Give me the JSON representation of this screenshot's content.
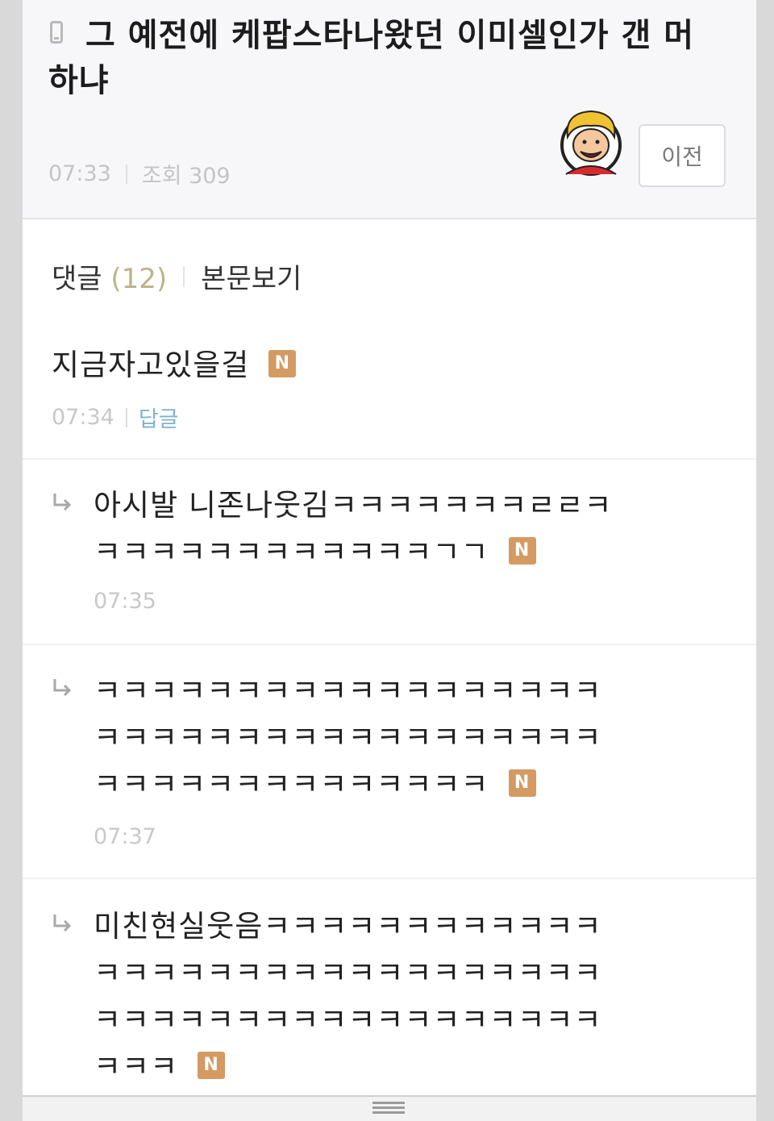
{
  "post": {
    "title": "그 예전에 케팝스타나왔던 이미셀인가 갠 머하냐",
    "time": "07:33",
    "views": "조회 309",
    "prev_button": "이전"
  },
  "comment_tabs": {
    "comments_label": "댓글",
    "comments_count": "(12)",
    "view_post_label": "본문보기"
  },
  "comments": [
    {
      "text": "지금자고있을걸",
      "badge": "N",
      "time": "07:34",
      "reply_label": "답글"
    },
    {
      "text_line1": "아시발 니존나웃김ㅋㅋㅋㅋㅋㅋㅋㄹㄹㅋ",
      "text_line2": "ㅋㅋㅋㅋㅋㅋㅋㅋㅋㅋㅋㅋㄱㄱ",
      "badge": "N",
      "time": "07:35"
    },
    {
      "text_line1": "ㅋㅋㅋㅋㅋㅋㅋㅋㅋㅋㅋㅋㅋㅋㅋㅋㅋㅋ",
      "text_line2": "ㅋㅋㅋㅋㅋㅋㅋㅋㅋㅋㅋㅋㅋㅋㅋㅋㅋㅋ",
      "text_line3": "ㅋㅋㅋㅋㅋㅋㅋㅋㅋㅋㅋㅋㅋㅋ",
      "badge": "N",
      "time": "07:37"
    },
    {
      "text_line1": "미친현실웃음ㅋㅋㅋㅋㅋㅋㅋㅋㅋㅋㅋㅋ",
      "text_line2": "ㅋㅋㅋㅋㅋㅋㅋㅋㅋㅋㅋㅋㅋㅋㅋㅋㅋㅋ",
      "text_line3": "ㅋㅋㅋㅋㅋㅋㅋㅋㅋㅋㅋㅋㅋㅋㅋㅋㅋㅋ",
      "text_line4": "ㅋㅋㅋ",
      "badge": "N"
    }
  ],
  "icons": {
    "device": "mobile-phone-icon",
    "reply": "reply-arrow-icon",
    "handle": "drag-handle-icon"
  },
  "colors": {
    "badge": "#d49a62",
    "reply_link": "#7fb3c8",
    "comment_count": "#bdb28a"
  }
}
